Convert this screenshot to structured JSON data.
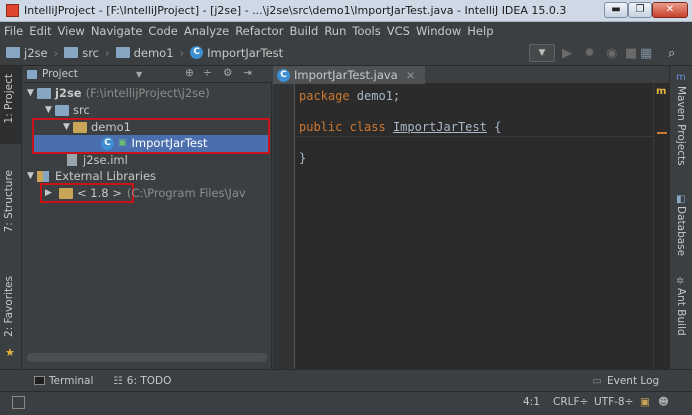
{
  "window": {
    "title": "IntelliJProject - [F:\\IntelliJProject] - [j2se] - ...\\j2se\\src\\demo1\\ImportJarTest.java - IntelliJ IDEA 15.0.3",
    "minimize": "▬",
    "maximize": "❐",
    "close": "✕"
  },
  "menu": [
    "File",
    "Edit",
    "View",
    "Navigate",
    "Code",
    "Analyze",
    "Refactor",
    "Build",
    "Run",
    "Tools",
    "VCS",
    "Window",
    "Help"
  ],
  "breadcrumbs": [
    {
      "label": "j2se",
      "icon": "module-folder-icon"
    },
    {
      "label": "src",
      "icon": "source-folder-icon"
    },
    {
      "label": "demo1",
      "icon": "package-folder-icon"
    },
    {
      "label": "ImportJarTest",
      "icon": "class-icon"
    }
  ],
  "left_tabs": {
    "project": "1: Project",
    "structure": "7: Structure",
    "favorites": "2: Favorites"
  },
  "project_panel": {
    "dropdown": "Project",
    "tree": {
      "root": "j2se",
      "root_path": "(F:\\intellijProject\\j2se)",
      "src": "src",
      "package": "demo1",
      "class": "ImportJarTest",
      "iml": "j2se.iml",
      "external": "External Libraries",
      "jdk": "< 1.8 >",
      "jdk_path": "(C:\\Program Files\\Jav"
    }
  },
  "editor": {
    "tab_label": "ImportJarTest.java",
    "tab_close": "×",
    "kw_package": "package",
    "package_rest": " demo1;",
    "kw_public": "public",
    "kw_class": " class ",
    "class_name": "ImportJarTest",
    "brace_open": " {",
    "brace_close": "}",
    "marker": "m"
  },
  "right_tabs": {
    "maven": "Maven Projects",
    "database": "Database",
    "ant": "Ant Build"
  },
  "bottom_tools": {
    "terminal": "Terminal",
    "todo": "6: TODO",
    "eventlog": "Event Log"
  },
  "status": {
    "position": "4:1",
    "line_sep": "CRLF÷",
    "encoding": "UTF-8÷"
  },
  "colors": {
    "accent": "#4b6eaf",
    "highlight": "#c8131b",
    "keyword": "#cc7832"
  }
}
